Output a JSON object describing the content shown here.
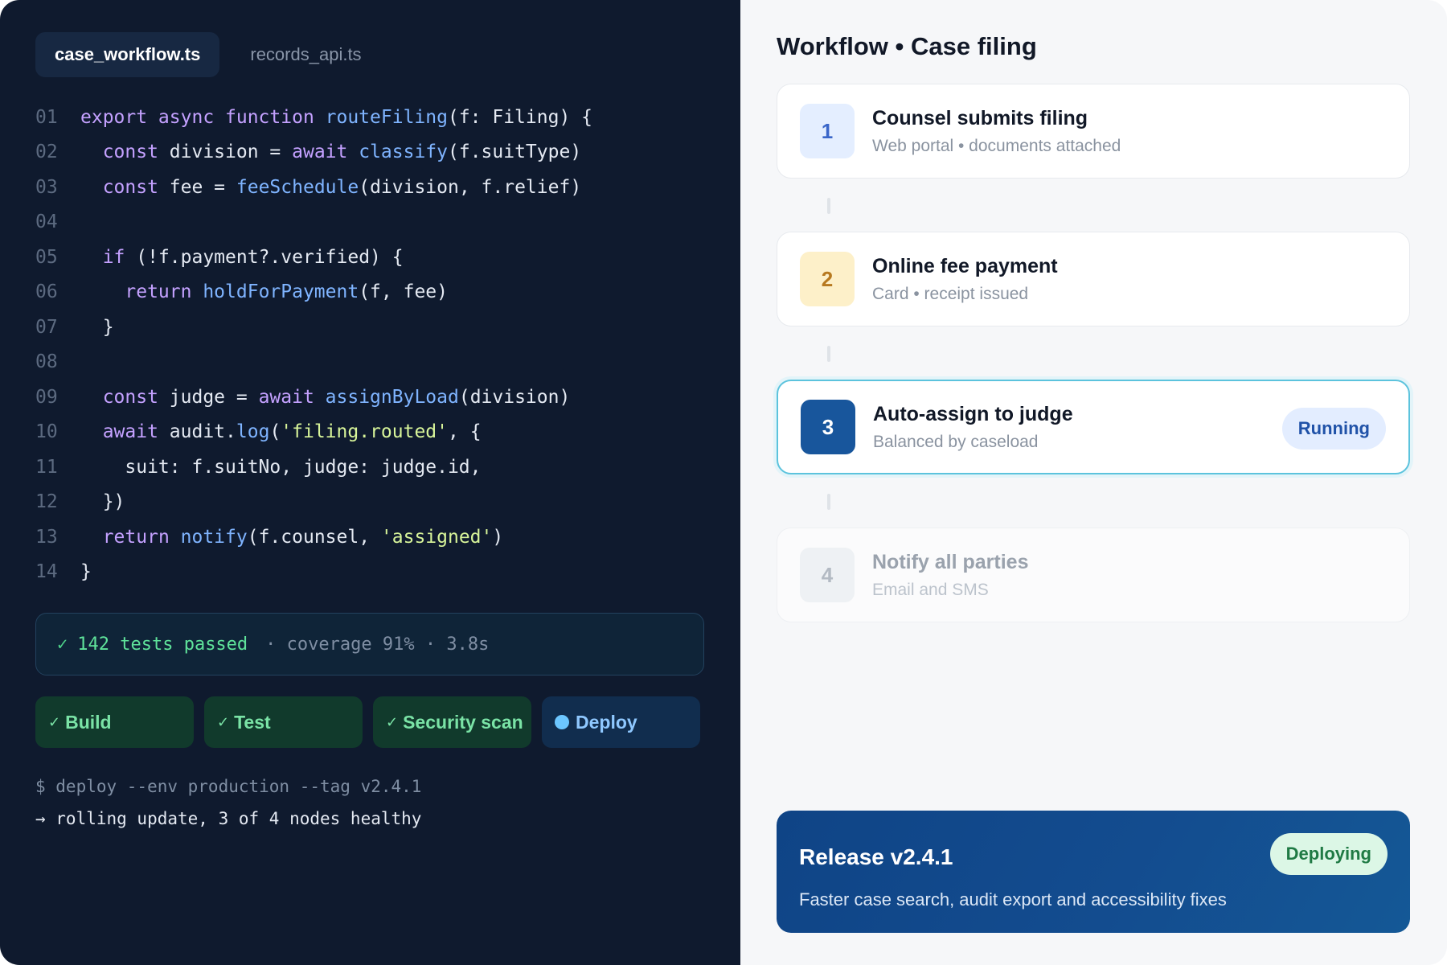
{
  "editor": {
    "tabs": [
      {
        "label": "case_workflow.ts",
        "active": true
      },
      {
        "label": "records_api.ts",
        "active": false
      }
    ],
    "code_lines": [
      {
        "n": "01",
        "tokens": [
          [
            "kw",
            "export async function "
          ],
          [
            "fn",
            "routeFiling"
          ],
          [
            "pl",
            "(f: Filing) {"
          ]
        ]
      },
      {
        "n": "02",
        "tokens": [
          [
            "pl",
            "  "
          ],
          [
            "kw",
            "const "
          ],
          [
            "pl",
            "division = "
          ],
          [
            "kw",
            "await "
          ],
          [
            "fn",
            "classify"
          ],
          [
            "pl",
            "(f.suitType)"
          ]
        ]
      },
      {
        "n": "03",
        "tokens": [
          [
            "pl",
            "  "
          ],
          [
            "kw",
            "const "
          ],
          [
            "pl",
            "fee = "
          ],
          [
            "fn",
            "feeSchedule"
          ],
          [
            "pl",
            "(division, f.relief)"
          ]
        ]
      },
      {
        "n": "04",
        "tokens": []
      },
      {
        "n": "05",
        "tokens": [
          [
            "pl",
            "  "
          ],
          [
            "kw",
            "if "
          ],
          [
            "pl",
            "(!f.payment?.verified) {"
          ]
        ]
      },
      {
        "n": "06",
        "tokens": [
          [
            "pl",
            "    "
          ],
          [
            "kw",
            "return "
          ],
          [
            "fn",
            "holdForPayment"
          ],
          [
            "pl",
            "(f, fee)"
          ]
        ]
      },
      {
        "n": "07",
        "tokens": [
          [
            "pl",
            "  }"
          ]
        ]
      },
      {
        "n": "08",
        "tokens": []
      },
      {
        "n": "09",
        "tokens": [
          [
            "pl",
            "  "
          ],
          [
            "kw",
            "const "
          ],
          [
            "pl",
            "judge = "
          ],
          [
            "kw",
            "await "
          ],
          [
            "fn",
            "assignByLoad"
          ],
          [
            "pl",
            "(division)"
          ]
        ]
      },
      {
        "n": "10",
        "tokens": [
          [
            "pl",
            "  "
          ],
          [
            "kw",
            "await "
          ],
          [
            "pl",
            "audit."
          ],
          [
            "fn",
            "log"
          ],
          [
            "pl",
            "("
          ],
          [
            "str",
            "'filing.routed'"
          ],
          [
            "pl",
            ", {"
          ]
        ]
      },
      {
        "n": "11",
        "tokens": [
          [
            "pl",
            "    suit: f.suitNo, judge: judge.id,"
          ]
        ]
      },
      {
        "n": "12",
        "tokens": [
          [
            "pl",
            "  })"
          ]
        ]
      },
      {
        "n": "13",
        "tokens": [
          [
            "pl",
            "  "
          ],
          [
            "kw",
            "return "
          ],
          [
            "fn",
            "notify"
          ],
          [
            "pl",
            "(f.counsel, "
          ],
          [
            "str",
            "'assigned'"
          ],
          [
            "pl",
            ")"
          ]
        ]
      },
      {
        "n": "14",
        "tokens": [
          [
            "pl",
            "}"
          ]
        ]
      }
    ],
    "tests": {
      "check": "✓",
      "passed": "142 tests passed",
      "meta": "· coverage 91% · 3.8s"
    },
    "pipeline": [
      {
        "label": "Build",
        "status": "done"
      },
      {
        "label": "Test",
        "status": "done"
      },
      {
        "label": "Security scan",
        "status": "done"
      },
      {
        "label": "Deploy",
        "status": "active"
      }
    ],
    "terminal": {
      "command": "$ deploy --env production --tag v2.4.1",
      "output": "→ rolling update, 3 of 4 nodes healthy"
    }
  },
  "workflow": {
    "title": "Workflow • Case filing",
    "steps": [
      {
        "num": "1",
        "title": "Counsel submits filing",
        "sub": "Web portal • documents attached"
      },
      {
        "num": "2",
        "title": "Online fee payment",
        "sub": "Card • receipt issued"
      },
      {
        "num": "3",
        "title": "Auto-assign to judge",
        "sub": "Balanced by caseload",
        "badge": "Running"
      },
      {
        "num": "4",
        "title": "Notify all parties",
        "sub": "Email and SMS"
      }
    ]
  },
  "release": {
    "title": "Release v2.4.1",
    "description": "Faster case search, audit export and accessibility fixes",
    "badge": "Deploying"
  },
  "colors": {
    "editor_bg": "#0f1a2e",
    "keyword": "#c4a1ff",
    "function": "#7fb4ff",
    "string": "#d8f59a",
    "success": "#5fe39b",
    "accent": "#18569c"
  }
}
